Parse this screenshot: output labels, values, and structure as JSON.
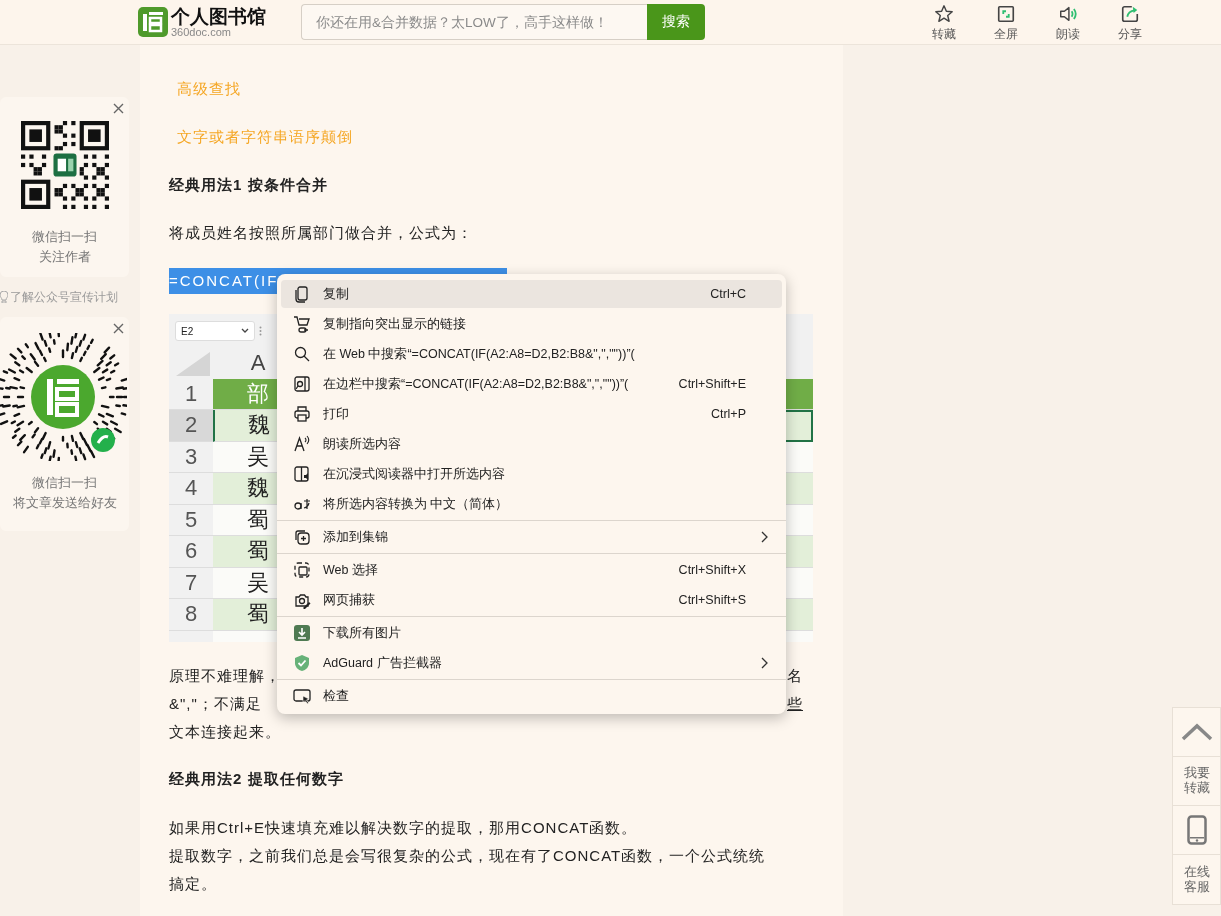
{
  "header": {
    "site_name": "个人图书馆",
    "domain": "360doc.com",
    "search": {
      "placeholder": "你还在用&合并数据？太LOW了，高手这样做！",
      "button": "搜索"
    },
    "actions": [
      {
        "label": "转藏",
        "kind": "star"
      },
      {
        "label": "全屏",
        "kind": "fullscreen"
      },
      {
        "label": "朗读",
        "kind": "speaker"
      },
      {
        "label": "分享",
        "kind": "share"
      }
    ]
  },
  "left_panels": [
    {
      "kind": "qr",
      "lines": [
        "微信扫一扫",
        "关注作者"
      ]
    },
    {
      "kind": "mini",
      "lines": [
        "微信扫一扫",
        "将文章发送给好友"
      ]
    }
  ],
  "promo_link": "了解公众号宣传计划",
  "article": {
    "links": [
      "高级查找",
      "文字或者字符串语序颠倒"
    ],
    "heading_1": "经典用法1 按条件合并",
    "intro": "将成员姓名按照所属部门做合并，公式为：",
    "selected_formula": "=CONCAT(IF",
    "sheet": {
      "name_box": "E2",
      "column": "A",
      "rows": [
        {
          "number": "1",
          "cell": "部",
          "selected": false
        },
        {
          "number": "2",
          "cell": "魏",
          "selected": true
        },
        {
          "number": "3",
          "cell": "吴",
          "selected": false
        },
        {
          "number": "4",
          "cell": "魏",
          "selected": false
        },
        {
          "number": "5",
          "cell": "蜀",
          "selected": false
        },
        {
          "number": "6",
          "cell": "蜀",
          "selected": false
        },
        {
          "number": "7",
          "cell": "吴",
          "selected": false
        },
        {
          "number": "8",
          "cell": "蜀",
          "selected": false
        }
      ]
    },
    "explanation_lines": [
      {
        "left": "原理不难理解，",
        "right": "名",
        "right_underlined": false
      },
      {
        "left": "&\",\"；不满足",
        "right": "些",
        "right_underlined": true
      },
      {
        "left": "文本连接起来。"
      }
    ],
    "heading_2": "经典用法2 提取任何数字",
    "paragraphs": [
      "如果用Ctrl+E快速填充难以解决数字的提取，那用CONCAT函数。",
      "提取数字，之前我们总是会写很复杂的公式，现在有了CONCAT函数，一个公式统统",
      "搞定。"
    ]
  },
  "context_menu": {
    "groups": [
      [
        {
          "label": "复制",
          "shortcut": "Ctrl+C",
          "selected": true
        },
        {
          "label": "复制指向突出显示的链接",
          "selected": false
        },
        {
          "label": "在 Web 中搜索“=CONCAT(IF(A2:A8=D2,B2:B8&\",\",\"\"))”(",
          "selected": false
        },
        {
          "label": "在边栏中搜索“=CONCAT(IF(A2:A8=D2,B2:B8&\",\",\"\"))”(",
          "shortcut": "Ctrl+Shift+E",
          "selected": false
        },
        {
          "label": "打印",
          "shortcut": "Ctrl+P",
          "selected": false
        },
        {
          "label": "朗读所选内容",
          "selected": false
        },
        {
          "label": "在沉浸式阅读器中打开所选内容",
          "selected": false
        },
        {
          "label": "将所选内容转换为 中文（简体）",
          "selected": false
        }
      ],
      [
        {
          "label": "添加到集锦",
          "submenu": true,
          "selected": false
        }
      ],
      [
        {
          "label": "Web 选择",
          "shortcut": "Ctrl+Shift+X",
          "selected": false
        },
        {
          "label": "网页捕获",
          "shortcut": "Ctrl+Shift+S",
          "selected": false
        }
      ],
      [
        {
          "label": "下载所有图片",
          "selected": false
        },
        {
          "label": "AdGuard 广告拦截器",
          "submenu": true,
          "selected": false
        }
      ],
      [
        {
          "label": "检查",
          "selected": false
        }
      ]
    ]
  },
  "float_bar": {
    "save": "我要转藏",
    "service": "在线客服"
  }
}
